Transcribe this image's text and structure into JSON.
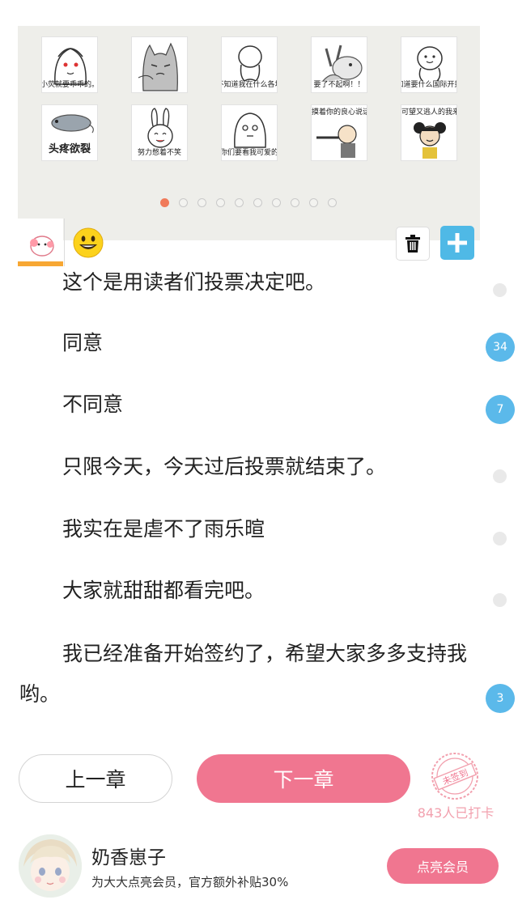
{
  "stickers": [
    {
      "name": "sticker-ghost-girl",
      "caption": "小荧就要乖乖的。"
    },
    {
      "name": "sticker-grumpy-cat",
      "caption": ""
    },
    {
      "name": "sticker-blob-thinking",
      "caption": "不知道我在什么各地"
    },
    {
      "name": "sticker-bunny-shout",
      "caption": "要了不起啊！！"
    },
    {
      "name": "sticker-blob-smile",
      "caption": "不知道要什么国际开封吗"
    },
    {
      "name": "sticker-sick-mouse",
      "caption": "头疼欲裂"
    },
    {
      "name": "sticker-rabbit-laugh",
      "caption": "努力憋着不笑"
    },
    {
      "name": "sticker-puzzled-face",
      "caption": "你们要看我可爱的"
    },
    {
      "name": "sticker-conscience",
      "caption": "摸着你的良心说话一"
    },
    {
      "name": "sticker-pigtail-girl",
      "caption": "可望又逃人的我来了"
    }
  ],
  "pager": {
    "count": 10,
    "active": 0
  },
  "tabs": [
    {
      "name": "tab-custom-stickers",
      "selected": true
    },
    {
      "name": "tab-emoji",
      "selected": false
    }
  ],
  "icons": {
    "delete": "trash-icon",
    "add": "plus-icon"
  },
  "paragraphs": [
    {
      "text": "这个是用读者们投票决定吧。",
      "comments": ""
    },
    {
      "text": "同意",
      "comments": "34"
    },
    {
      "text": "不同意",
      "comments": "7"
    },
    {
      "text": "只限今天，今天过后投票就结束了。",
      "comments": ""
    },
    {
      "text": "我实在是虐不了雨乐暄",
      "comments": ""
    },
    {
      "text": "大家就甜甜都看完吧。",
      "comments": ""
    },
    {
      "text": "我已经准备开始签约了，希望大家多多支持我哟。",
      "comments": "3"
    }
  ],
  "nav": {
    "prev_label": "上一章",
    "next_label": "下一章"
  },
  "checkin": {
    "stamp_text": "未签到",
    "count_label": "843人已打卡"
  },
  "author": {
    "name": "奶香崽子",
    "promo": "为大大点亮会员，官方额外补贴30%",
    "member_button": "点亮会员"
  },
  "colors": {
    "accent_pink": "#f07690",
    "badge_blue": "#5bb9ea",
    "active_dot": "#f07a5a",
    "add_blue": "#4fb9e6",
    "tab_underline": "#f7a733"
  }
}
